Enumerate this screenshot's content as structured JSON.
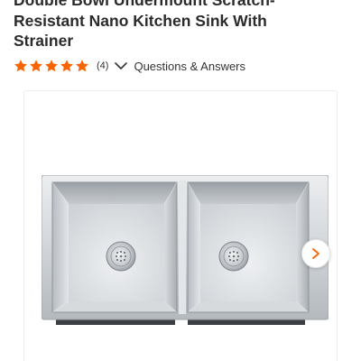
{
  "product": {
    "title_lines": [
      "Double Bowl Undermount Scratch-",
      "Resistant Nano Kitchen Sink With",
      "Strainer"
    ],
    "rating": {
      "value": 5,
      "max": 5,
      "review_count": "(4)"
    },
    "qa_label": "Questions & Answers"
  },
  "icons": {
    "star": "star-icon",
    "qa_chevron": "chevron-down-icon",
    "next": "chevron-right-icon"
  },
  "colors": {
    "star": "#f96302",
    "chevron": "#f96302",
    "title": "#2b2b2b"
  }
}
